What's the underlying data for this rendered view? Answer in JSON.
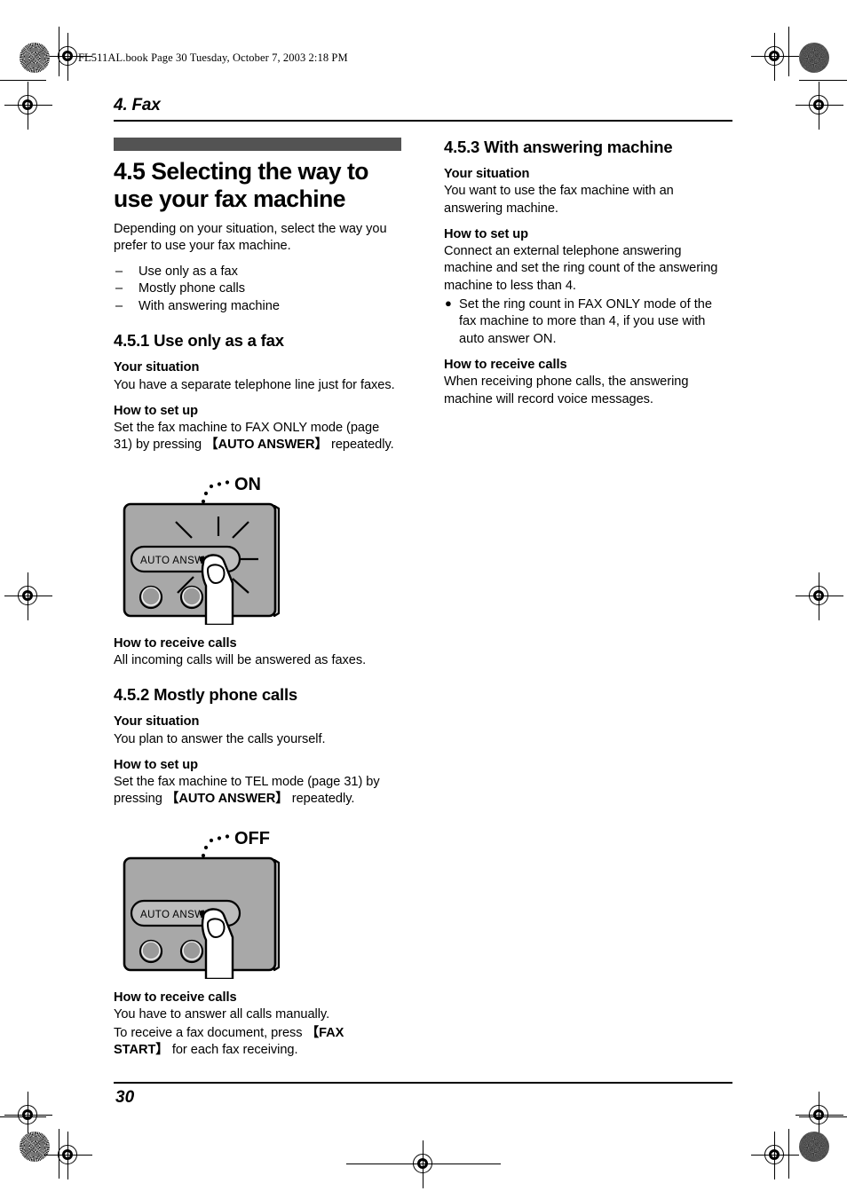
{
  "page": {
    "filestamp": "FL511AL.book  Page 30  Tuesday, October 7, 2003  2:18 PM",
    "running_head": "4. Fax",
    "page_number": "30",
    "bar_color": "#535353",
    "panel_color": "#a8a8a8"
  },
  "left_column": {
    "section_title": "4.5 Selecting the way to use your fax machine",
    "intro": "Depending on your situation, select the way you prefer to use your fax machine.",
    "options": [
      "Use only as a fax",
      "Mostly phone calls",
      "With answering machine"
    ],
    "dash_glyph": "–",
    "sub1": {
      "title": "4.5.1 Use only as a fax",
      "situation_label": "Your situation",
      "situation_text": "You have a separate telephone line just for faxes.",
      "setup_label": "How to set up",
      "setup_text_a": "Set the fax machine to FAX ONLY mode (page 31) by pressing ",
      "setup_key": "【AUTO ANSWER】",
      "setup_text_b": " repeatedly.",
      "receive_label": "How to receive calls",
      "receive_text": "All incoming calls will be answered as faxes.",
      "figure": {
        "callout": "ON",
        "button_label": "AUTO ANSWER",
        "led_state": "on"
      }
    },
    "sub2": {
      "title": "4.5.2 Mostly phone calls",
      "situation_label": "Your situation",
      "situation_text": "You plan to answer the calls yourself.",
      "setup_label": "How to set up",
      "setup_text_a": "Set the fax machine to TEL mode (page 31) by pressing ",
      "setup_key": "【AUTO ANSWER】",
      "setup_text_b": " repeatedly.",
      "receive_label": "How to receive calls",
      "receive_text_1": "You have to answer all calls manually.",
      "receive_text_2a": "To receive a fax document, press ",
      "receive_key": "【FAX START】",
      "receive_text_2b": " for each fax receiving.",
      "figure": {
        "callout": "OFF",
        "button_label": "AUTO ANSWER",
        "led_state": "off"
      }
    }
  },
  "right_column": {
    "sub3": {
      "title": "4.5.3 With answering machine",
      "situation_label": "Your situation",
      "situation_text": "You want to use the fax machine with an answering machine.",
      "setup_label": "How to set up",
      "setup_text": "Connect an external telephone answering machine and set the ring count of the answering machine to less than 4.",
      "bullet_glyph": "●",
      "bullets": [
        "Set the ring count in FAX ONLY mode of the fax machine to more than 4, if you use with auto answer ON."
      ],
      "receive_label": "How to receive calls",
      "receive_text": "When receiving phone calls, the answering machine will record voice messages."
    }
  }
}
